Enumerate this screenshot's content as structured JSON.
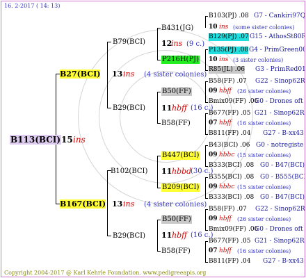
{
  "header": {
    "date": "16. 2-2017 ( 14: 13)"
  },
  "footer": {
    "text": "Copyright 2004-2017 @ Karl Kehrle Foundation.   www.pedigreeapis.org"
  },
  "colors": {
    "yellow": "#ffff33",
    "gray": "#c8c8c8",
    "green": "#22ee22",
    "cyan": "#22dddd",
    "ins_red": "#d00000",
    "blue_text": "#3030c0",
    "frame": "#d070d0"
  },
  "gen1": {
    "name": "B113(BCI)",
    "num": "15",
    "ins": "ins"
  },
  "gen2": {
    "top": {
      "name": "B27(BCI)",
      "num": "13",
      "ins": "ins",
      "note": "(4 sister colonies)"
    },
    "bottom": {
      "name": "B167(BCI)",
      "num": "13",
      "ins": "ins",
      "note": "(4 sister colonies)"
    }
  },
  "gen3": {
    "b79": {
      "name": "B79(BCI)"
    },
    "b29a": {
      "name": "B29(BCI)",
      "num": "11",
      "ins": "hbff",
      "note": "(16 c.)"
    },
    "b102": {
      "name": "B102(BCI)",
      "num": "11",
      "ins": "hbbd",
      "note": "(30 c.)"
    },
    "b29b": {
      "name": "B29(BCI)",
      "num": "11",
      "ins": "hbff",
      "note": "(16 c.)"
    }
  },
  "gen4": {
    "b431": {
      "name": "B431(JG)",
      "num": "12",
      "ins": "ins",
      "note": "(9 c.)"
    },
    "p216": {
      "name": "P216H(PJ)",
      "num": "10",
      "ins": "ins",
      "note": "(3 sister colonies)"
    },
    "b50a": {
      "name": "B50(FF)",
      "num": "09",
      "ins": "hbff",
      "note": "(26 sister colonies)"
    },
    "b58a": {
      "name": "B58(FF)",
      "num": "07",
      "ins": "hbff",
      "note": "(16 sister colonies)"
    },
    "b447": {
      "name": "B447(BCI)",
      "num": "09",
      "ins": "hbbc",
      "note": "(15 sister colonies)"
    },
    "b209": {
      "name": "B209(BCI)",
      "num": "09",
      "ins": "hbbc",
      "note": "(15 sister colonies)"
    },
    "b50b": {
      "name": "B50(FF)",
      "num": "09",
      "ins": "hbff",
      "note": "(26 sister colonies)"
    },
    "b58b": {
      "name": "B58(FF)",
      "num": "07",
      "ins": "hbff",
      "note": "(16 sister colonies)"
    }
  },
  "gen5": {
    "r1": {
      "name": "B103(PJ)",
      "val": ".08",
      "desc": "G7 - Cankiri97Q"
    },
    "r2": {
      "num": "10",
      "ins": "ins",
      "note": "(some sister colonies)"
    },
    "r3": {
      "name": "B129(PJ)",
      "val": ".07",
      "desc": "G15 - AthosSt80R"
    },
    "r4": {
      "name": "P135(PJ)",
      "val": ".08",
      "desc": "G4 - PrimGreen00"
    },
    "r5": {
      "name": "R85(JL)",
      "val": ".06",
      "desc": "G3 - PrimRed01"
    },
    "r6": {
      "name": "B58(FF)",
      "val": ".07",
      "desc": "G22 - Sinop62R"
    },
    "r7": {
      "name": "Bmix09(FF)",
      "val": ".06",
      "desc": "G0 - Drones oft"
    },
    "r8": {
      "name": "B677(FF)",
      "val": ".05",
      "desc": "G21 - Sinop62R"
    },
    "r9": {
      "name": "B811(FF)",
      "val": ".04",
      "desc": "G27 - B-xx43"
    },
    "r10": {
      "name": "B43(BCI)",
      "val": ".06",
      "desc": "G0 - notregiste"
    },
    "r11": {
      "name": "B333(BCI)",
      "val": ".08",
      "desc": "G0 - B47(BCI)"
    },
    "r12": {
      "name": "B355(BCI)",
      "val": ".08",
      "desc": "G0 - B555(BCI)"
    },
    "r13": {
      "name": "B333(BCI)",
      "val": ".08",
      "desc": "G0 - B47(BCI)"
    },
    "r14": {
      "name": "B58(FF)",
      "val": ".07",
      "desc": "G22 - Sinop62R"
    },
    "r15": {
      "name": "Bmix09(FF)",
      "val": ".06",
      "desc": "G0 - Drones oft"
    },
    "r16": {
      "name": "B677(FF)",
      "val": ".05",
      "desc": "G21 - Sinop62R"
    },
    "r17": {
      "name": "B811(FF)",
      "val": ".04",
      "desc": "G27 - B-xx43"
    }
  }
}
